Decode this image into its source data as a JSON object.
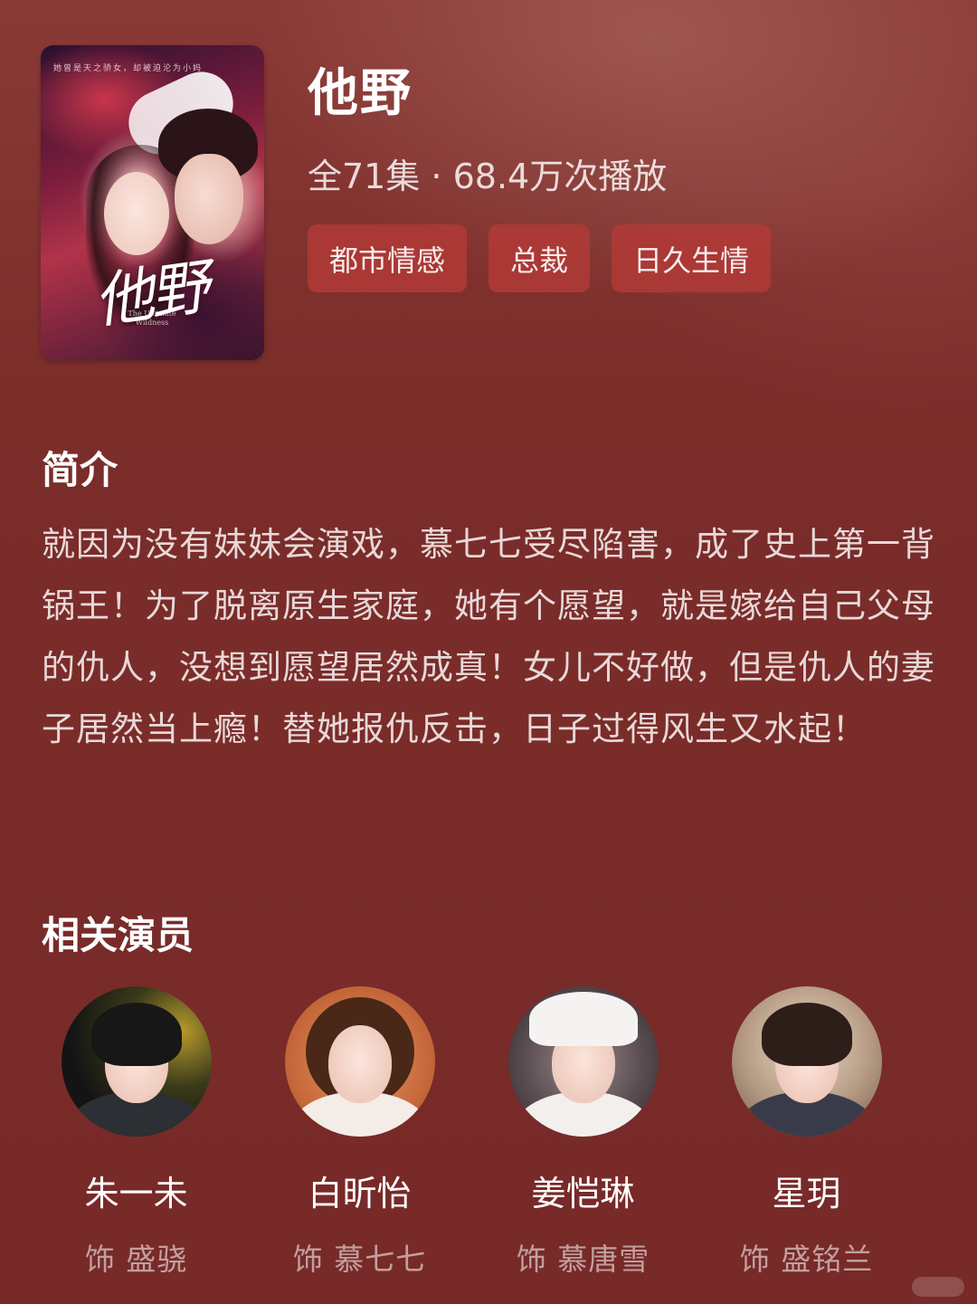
{
  "show": {
    "poster_top_text": "她曾是天之骄女，却被迫沦为小妈",
    "poster_title_art": "他野",
    "poster_subtitle_art": "The Ultimate Wildness",
    "title": "他野",
    "meta": "全71集 · 68.4万次播放",
    "tags": [
      "都市情感",
      "总裁",
      "日久生情"
    ]
  },
  "synopsis": {
    "heading": "简介",
    "text": "就因为没有妹妹会演戏，慕七七受尽陷害，成了史上第一背锅王！为了脱离原生家庭，她有个愿望，就是嫁给自己父母的仇人，没想到愿望居然成真！女儿不好做，但是仇人的妻子居然当上瘾！替她报仇反击，日子过得风生又水起！"
  },
  "cast": {
    "heading": "相关演员",
    "actors": [
      {
        "name": "朱一未",
        "role": "饰 盛骁"
      },
      {
        "name": "白昕怡",
        "role": "饰 慕七七"
      },
      {
        "name": "姜恺琳",
        "role": "饰 慕唐雪"
      },
      {
        "name": "星玥",
        "role": "饰 盛铭兰"
      }
    ]
  }
}
